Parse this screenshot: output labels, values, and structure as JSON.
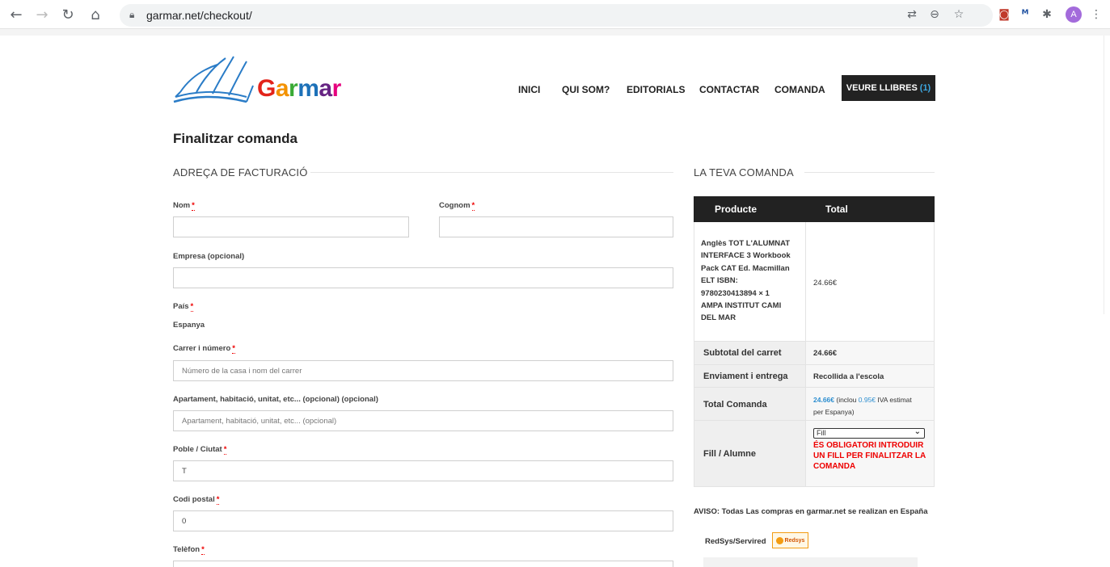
{
  "browser": {
    "url": "garmar.net/checkout/",
    "avatar_letter": "A"
  },
  "site": {
    "brand": "Garmar",
    "nav": [
      "INICI",
      "QUI SOM?",
      "EDITORIALS",
      "CONTACTAR",
      "COMANDA"
    ],
    "cart_label": "VEURE LLIBRES",
    "cart_count": "(1)"
  },
  "page": {
    "title": "Finalitzar comanda"
  },
  "billing": {
    "section_title": "ADREÇA DE FACTURACIÓ",
    "required_mark": "*",
    "nom_label": "Nom",
    "cognom_label": "Cognom",
    "empresa_label": "Empresa (opcional)",
    "pais_label": "País",
    "pais_value": "Espanya",
    "carrer_label": "Carrer i número",
    "carrer_placeholder": "Número de la casa i nom del carrer",
    "apartament_label": "Apartament, habitació, unitat, etc... (opcional) (opcional)",
    "apartament_placeholder": "Apartament, habitació, unitat, etc... (opcional)",
    "poble_label": "Poble / Ciutat",
    "poble_value": "T",
    "codi_label": "Codi postal",
    "codi_value": "0",
    "telefon_label": "Telèfon"
  },
  "order": {
    "section_title": "LA TEVA COMANDA",
    "col_product": "Producte",
    "col_total": "Total",
    "product_lines": [
      "Anglès TOT L'ALUMNAT",
      "INTERFACE 3 Workbook",
      "Pack CAT Ed. Macmillan",
      "ELT ISBN:",
      "9780230413894 × 1",
      "AMPA INSTITUT CAMI",
      "DEL MAR"
    ],
    "product_total": "24.66€",
    "subtotal_label": "Subtotal del carret",
    "subtotal_value": "24.66€",
    "shipping_label": "Enviament i entrega",
    "shipping_value": "Recollida a l'escola",
    "total_label": "Total Comanda",
    "total_value": "24.66€",
    "total_note_a": " (inclou ",
    "total_tax": "0.95€",
    "total_note_b": " IVA estimat",
    "total_note_c": "per Espanya)",
    "fill_label": "Fill / Alumne",
    "fill_select": "Fill",
    "fill_error_lines": [
      "ÉS OBLIGATORI INTRODUIR",
      "UN FILL PER FINALITZAR LA",
      "COMANDA"
    ],
    "aviso": "AVISO: Todas Las compras en garmar.net se realizan en España",
    "payment_label": "RedSys/Servired",
    "payment_logo": "Redsys"
  },
  "colors": {
    "logo_letters": [
      "#e2231a",
      "#f39200",
      "#3aaa35",
      "#1d71b8",
      "#662483",
      "#e6007e"
    ]
  }
}
